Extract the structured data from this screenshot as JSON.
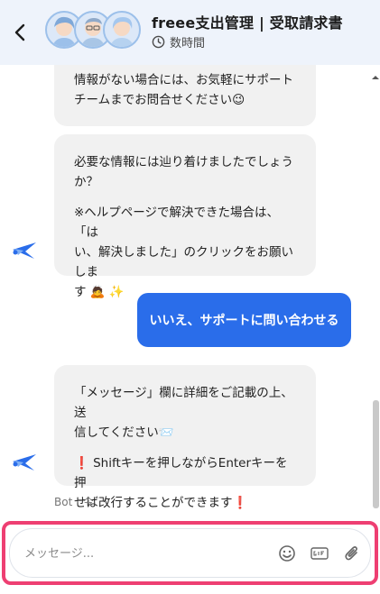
{
  "header": {
    "title": "freee支出管理 | 受取請求書",
    "subtitle": "数時間"
  },
  "messages": {
    "m1_line1": "情報がない場合には、お気軽にサポート",
    "m1_line2": "チームまでお問合せください😉",
    "m2_line1": "必要な情報には辿り着けましたでしょう",
    "m2_line2": "か？",
    "m2_line3": "※ヘルプページで解決できた場合は、「は",
    "m2_line4": "い、解決しました」のクリックをお願いしま",
    "m2_line5": "す 🙇 ✨",
    "user_reply": "いいえ、サポートに問い合わせる",
    "m3_line1": "「メッセージ」欄に詳細をご記載の上、送",
    "m3_line2": "信してください📨",
    "m3_line3": "❗ Shiftキーを押しながらEnterキーを押",
    "m3_line4": "せば改行することができます❗",
    "meta": "Bot · 今."
  },
  "composer": {
    "placeholder": "メッセージ..."
  },
  "colors": {
    "header_bg": "#eef3fb",
    "accent_blue": "#2a6dea",
    "highlight_pink": "#ee3f72",
    "bubble_bg": "#f1f1f1"
  },
  "icons": [
    "back-arrow-icon",
    "clock-icon",
    "bot-bird-icon",
    "emoji-icon",
    "gif-icon",
    "attachment-icon",
    "scroll-up-icon"
  ]
}
